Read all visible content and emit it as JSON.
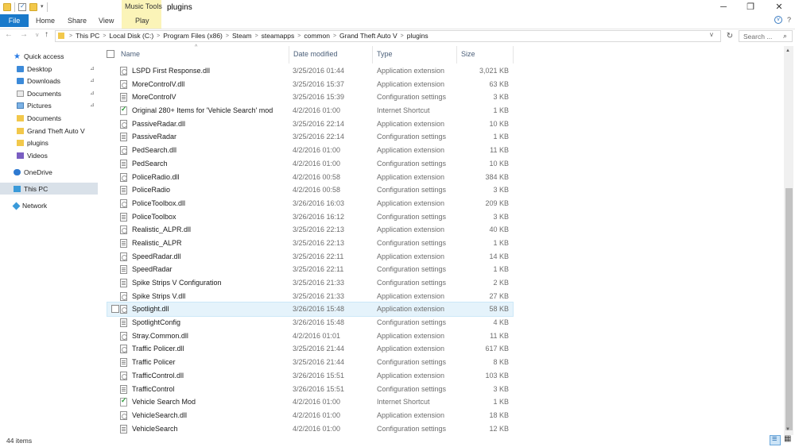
{
  "window": {
    "title": "plugins",
    "contextual_tab_group": "Music Tools",
    "minimize": "─",
    "maximize": "❐",
    "close": "✕"
  },
  "ribbon": {
    "tabs": [
      "File",
      "Home",
      "Share",
      "View",
      "Play"
    ],
    "collapse": "v",
    "help": "?"
  },
  "nav": {
    "back": "←",
    "forward": "→",
    "recent": "v",
    "up": "↑"
  },
  "address": {
    "crumbs": [
      "This PC",
      "Local Disk (C:)",
      "Program Files (x86)",
      "Steam",
      "steamapps",
      "common",
      "Grand Theft Auto V",
      "plugins"
    ],
    "separator": ">",
    "dropdown": "v",
    "refresh": "↻"
  },
  "search": {
    "placeholder": "Search ...",
    "icon": "⌕"
  },
  "sidebar": {
    "items": [
      {
        "label": "Quick access",
        "icon": "star-icon",
        "pinned": false
      },
      {
        "label": "Desktop",
        "icon": "desktop-icon",
        "pinned": true
      },
      {
        "label": "Downloads",
        "icon": "downloads-icon",
        "pinned": true
      },
      {
        "label": "Documents",
        "icon": "documents-icon",
        "pinned": true
      },
      {
        "label": "Pictures",
        "icon": "pictures-icon",
        "pinned": true
      },
      {
        "label": "Documents",
        "icon": "folder-icon",
        "pinned": false
      },
      {
        "label": "Grand Theft Auto V",
        "icon": "folder-icon",
        "pinned": false
      },
      {
        "label": "plugins",
        "icon": "folder-icon",
        "pinned": false
      },
      {
        "label": "Videos",
        "icon": "videos-icon",
        "pinned": false
      },
      {
        "label": "OneDrive",
        "icon": "onedrive-icon",
        "pinned": false
      },
      {
        "label": "This PC",
        "icon": "this-pc-icon",
        "pinned": false,
        "selected": true
      },
      {
        "label": "Network",
        "icon": "network-icon",
        "pinned": false
      }
    ],
    "pin_glyph": "📌"
  },
  "columns": {
    "name": "Name",
    "date": "Date modified",
    "type": "Type",
    "size": "Size",
    "sort_glyph": "^"
  },
  "files": [
    {
      "name": "LSPD First Response.dll",
      "date": "3/25/2016 01:44",
      "type": "Application extension",
      "size": "3,021 KB",
      "kind": "dll"
    },
    {
      "name": "MoreControlV.dll",
      "date": "3/25/2016 15:37",
      "type": "Application extension",
      "size": "63 KB",
      "kind": "dll"
    },
    {
      "name": "MoreControlV",
      "date": "3/25/2016 15:39",
      "type": "Configuration settings",
      "size": "3 KB",
      "kind": "cfg"
    },
    {
      "name": "Original 280+ Items for 'Vehicle Search' mod",
      "date": "4/2/2016 01:00",
      "type": "Internet Shortcut",
      "size": "1 KB",
      "kind": "url"
    },
    {
      "name": "PassiveRadar.dll",
      "date": "3/25/2016 22:14",
      "type": "Application extension",
      "size": "10 KB",
      "kind": "dll"
    },
    {
      "name": "PassiveRadar",
      "date": "3/25/2016 22:14",
      "type": "Configuration settings",
      "size": "1 KB",
      "kind": "cfg"
    },
    {
      "name": "PedSearch.dll",
      "date": "4/2/2016 01:00",
      "type": "Application extension",
      "size": "11 KB",
      "kind": "dll"
    },
    {
      "name": "PedSearch",
      "date": "4/2/2016 01:00",
      "type": "Configuration settings",
      "size": "10 KB",
      "kind": "cfg"
    },
    {
      "name": "PoliceRadio.dll",
      "date": "4/2/2016 00:58",
      "type": "Application extension",
      "size": "384 KB",
      "kind": "dll"
    },
    {
      "name": "PoliceRadio",
      "date": "4/2/2016 00:58",
      "type": "Configuration settings",
      "size": "3 KB",
      "kind": "cfg"
    },
    {
      "name": "PoliceToolbox.dll",
      "date": "3/26/2016 16:03",
      "type": "Application extension",
      "size": "209 KB",
      "kind": "dll"
    },
    {
      "name": "PoliceToolbox",
      "date": "3/26/2016 16:12",
      "type": "Configuration settings",
      "size": "3 KB",
      "kind": "cfg"
    },
    {
      "name": "Realistic_ALPR.dll",
      "date": "3/25/2016 22:13",
      "type": "Application extension",
      "size": "40 KB",
      "kind": "dll"
    },
    {
      "name": "Realistic_ALPR",
      "date": "3/25/2016 22:13",
      "type": "Configuration settings",
      "size": "1 KB",
      "kind": "cfg"
    },
    {
      "name": "SpeedRadar.dll",
      "date": "3/25/2016 22:11",
      "type": "Application extension",
      "size": "14 KB",
      "kind": "dll"
    },
    {
      "name": "SpeedRadar",
      "date": "3/25/2016 22:11",
      "type": "Configuration settings",
      "size": "1 KB",
      "kind": "cfg"
    },
    {
      "name": "Spike Strips V Configuration",
      "date": "3/25/2016 21:33",
      "type": "Configuration settings",
      "size": "2 KB",
      "kind": "cfg"
    },
    {
      "name": "Spike Strips V.dll",
      "date": "3/25/2016 21:33",
      "type": "Application extension",
      "size": "27 KB",
      "kind": "dll"
    },
    {
      "name": "Spotlight.dll",
      "date": "3/26/2016 15:48",
      "type": "Application extension",
      "size": "58 KB",
      "kind": "dll",
      "hover": true
    },
    {
      "name": "SpotlightConfig",
      "date": "3/26/2016 15:48",
      "type": "Configuration settings",
      "size": "4 KB",
      "kind": "cfg"
    },
    {
      "name": "Stray.Common.dll",
      "date": "4/2/2016 01:01",
      "type": "Application extension",
      "size": "11 KB",
      "kind": "dll"
    },
    {
      "name": "Traffic Policer.dll",
      "date": "3/25/2016 21:44",
      "type": "Application extension",
      "size": "617 KB",
      "kind": "dll"
    },
    {
      "name": "Traffic Policer",
      "date": "3/25/2016 21:44",
      "type": "Configuration settings",
      "size": "8 KB",
      "kind": "cfg"
    },
    {
      "name": "TrafficControl.dll",
      "date": "3/26/2016 15:51",
      "type": "Application extension",
      "size": "103 KB",
      "kind": "dll"
    },
    {
      "name": "TrafficControl",
      "date": "3/26/2016 15:51",
      "type": "Configuration settings",
      "size": "3 KB",
      "kind": "cfg"
    },
    {
      "name": "Vehicle Search Mod",
      "date": "4/2/2016 01:00",
      "type": "Internet Shortcut",
      "size": "1 KB",
      "kind": "url"
    },
    {
      "name": "VehicleSearch.dll",
      "date": "4/2/2016 01:00",
      "type": "Application extension",
      "size": "18 KB",
      "kind": "dll"
    },
    {
      "name": "VehicleSearch",
      "date": "4/2/2016 01:00",
      "type": "Configuration settings",
      "size": "12 KB",
      "kind": "cfg"
    }
  ],
  "status": {
    "item_count": "44 items"
  },
  "scrollbar": {
    "up": "▲",
    "down": "▼"
  }
}
